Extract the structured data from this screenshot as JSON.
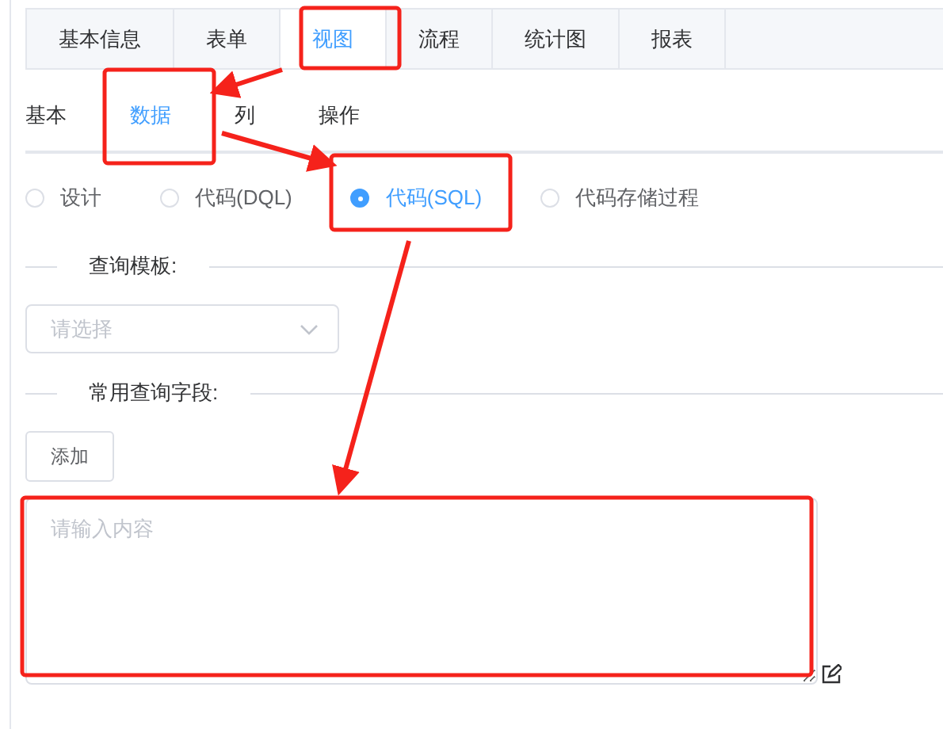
{
  "tabs": [
    {
      "label": "基本信息",
      "selected": false
    },
    {
      "label": "表单",
      "selected": false
    },
    {
      "label": "视图",
      "selected": true
    },
    {
      "label": "流程",
      "selected": false
    },
    {
      "label": "统计图",
      "selected": false
    },
    {
      "label": "报表",
      "selected": false
    }
  ],
  "subtabs": [
    {
      "label": "基本",
      "selected": false
    },
    {
      "label": "数据",
      "selected": true
    },
    {
      "label": "列",
      "selected": false
    },
    {
      "label": "操作",
      "selected": false
    }
  ],
  "source_options": [
    {
      "label": "设计",
      "selected": false
    },
    {
      "label": "代码(DQL)",
      "selected": false
    },
    {
      "label": "代码(SQL)",
      "selected": true
    },
    {
      "label": "代码存储过程",
      "selected": false
    }
  ],
  "query_template": {
    "title": "查询模板:",
    "placeholder": "请选择"
  },
  "common_fields": {
    "title": "常用查询字段:",
    "add_button": "添加"
  },
  "sql_editor": {
    "placeholder": "请输入内容"
  },
  "annotations": [
    {
      "kind": "frame"
    },
    {
      "kind": "frame"
    },
    {
      "kind": "frame"
    },
    {
      "kind": "frame"
    },
    {
      "kind": "arrow"
    },
    {
      "kind": "arrow"
    },
    {
      "kind": "arrow"
    }
  ]
}
